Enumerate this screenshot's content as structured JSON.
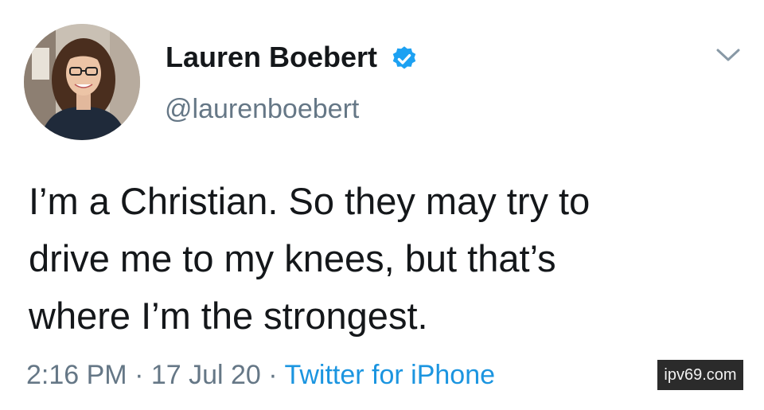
{
  "tweet": {
    "author": {
      "display_name": "Lauren Boebert",
      "handle": "@laurenboebert",
      "verified": true,
      "avatar_icon": "profile-photo"
    },
    "text_lines": [
      "I’m a Christian. So they may try to",
      "drive me to my knees, but that’s",
      "where I’m the strongest."
    ],
    "time": "2:16 PM",
    "separator": " · ",
    "date": "17 Jul 20",
    "source": "Twitter for iPhone",
    "menu_icon": "chevron-down-icon"
  },
  "watermark": {
    "text": "ipv69.com"
  },
  "colors": {
    "text": "#14171a",
    "secondary": "#657786",
    "link": "#1b95e0",
    "verified": "#1da1f2"
  }
}
